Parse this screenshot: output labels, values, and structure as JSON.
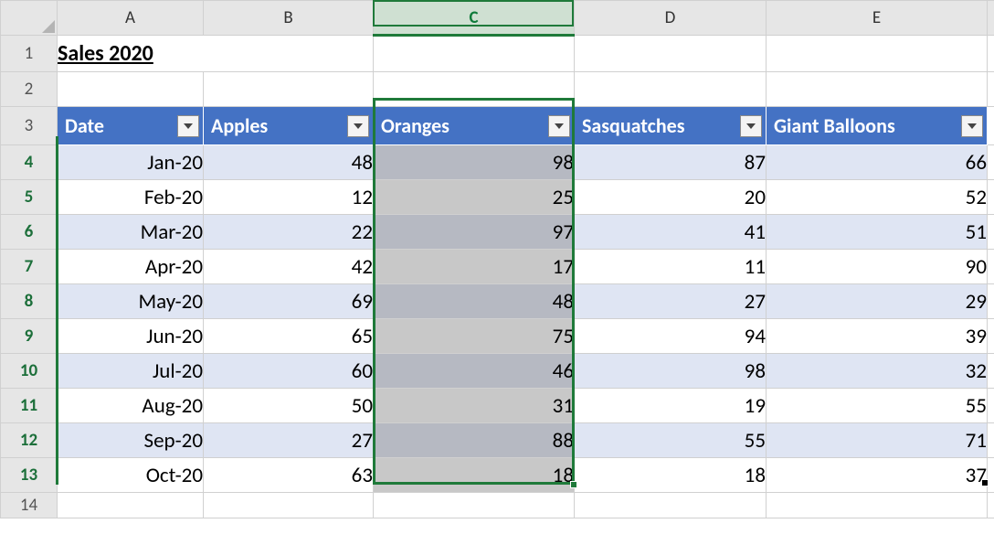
{
  "cols": {
    "A": "A",
    "B": "B",
    "C": "C",
    "D": "D",
    "E": "E"
  },
  "rownums": [
    "1",
    "2",
    "3",
    "4",
    "5",
    "6",
    "7",
    "8",
    "9",
    "10",
    "11",
    "12",
    "13",
    "14"
  ],
  "title": "Sales 2020",
  "table": {
    "headers": {
      "date": "Date",
      "apples": "Apples",
      "oranges": "Oranges",
      "sasquatches": "Sasquatches",
      "giant_balloons": "Giant Balloons"
    },
    "rows": [
      {
        "date": "Jan-20",
        "apples": "48",
        "oranges": "98",
        "sasquatches": "87",
        "giant_balloons": "66"
      },
      {
        "date": "Feb-20",
        "apples": "12",
        "oranges": "25",
        "sasquatches": "20",
        "giant_balloons": "52"
      },
      {
        "date": "Mar-20",
        "apples": "22",
        "oranges": "97",
        "sasquatches": "41",
        "giant_balloons": "51"
      },
      {
        "date": "Apr-20",
        "apples": "42",
        "oranges": "17",
        "sasquatches": "11",
        "giant_balloons": "90"
      },
      {
        "date": "May-20",
        "apples": "69",
        "oranges": "48",
        "sasquatches": "27",
        "giant_balloons": "29"
      },
      {
        "date": "Jun-20",
        "apples": "65",
        "oranges": "75",
        "sasquatches": "94",
        "giant_balloons": "39"
      },
      {
        "date": "Jul-20",
        "apples": "60",
        "oranges": "46",
        "sasquatches": "98",
        "giant_balloons": "32"
      },
      {
        "date": "Aug-20",
        "apples": "50",
        "oranges": "31",
        "sasquatches": "19",
        "giant_balloons": "55"
      },
      {
        "date": "Sep-20",
        "apples": "27",
        "oranges": "88",
        "sasquatches": "55",
        "giant_balloons": "71"
      },
      {
        "date": "Oct-20",
        "apples": "63",
        "oranges": "18",
        "sasquatches": "18",
        "giant_balloons": "37"
      }
    ]
  },
  "selection": {
    "active_column": "C",
    "range": "C3:C13"
  }
}
